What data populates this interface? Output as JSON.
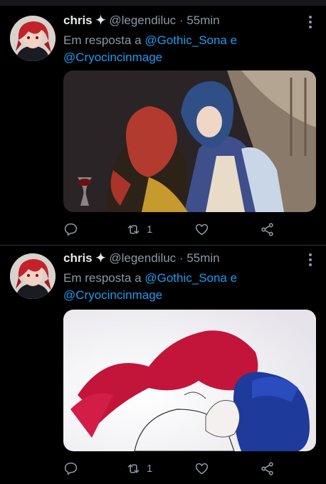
{
  "tweets": [
    {
      "name": "chris",
      "badge": "✦",
      "handle": "@legendiluc",
      "sep": "·",
      "time": "55min",
      "reply_prefix": "Em resposta a",
      "mention1": "@Gothic_Sona",
      "conj": "e",
      "mention2": "@Cryocincinmage",
      "retweets": "1"
    },
    {
      "name": "chris",
      "badge": "✦",
      "handle": "@legendiluc",
      "sep": "·",
      "time": "55min",
      "reply_prefix": "Em resposta a",
      "mention1": "@Gothic_Sona",
      "conj": "e",
      "mention2": "@Cryocincinmage",
      "retweets": "1"
    }
  ],
  "icons": {
    "reply": "reply-icon",
    "retweet": "retweet-icon",
    "like": "heart-icon",
    "share": "share-icon",
    "more": "more-vertical-icon"
  },
  "colors": {
    "background": "#000000",
    "mention": "#1d9bf0",
    "muted": "#8b98a5",
    "name": "#e7e9ea"
  }
}
